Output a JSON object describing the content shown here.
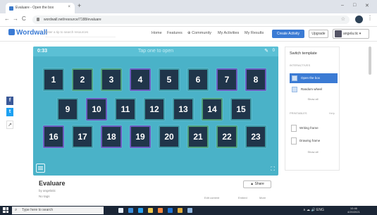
{
  "browser": {
    "tab_title": "Evaluare - Open the box",
    "tab_close": "×",
    "new_tab": "+",
    "window_controls": [
      "–",
      "□",
      "✕"
    ],
    "nav": {
      "back": "←",
      "forward": "→",
      "reload": "C"
    },
    "url": "wordwall.net/resource/7188/evaluare",
    "star": "☆",
    "menu": "⋮"
  },
  "wordwall": {
    "logo": "Wordwall",
    "search_placeholder": "Enter a tip to search resources",
    "nav": [
      "Home",
      "Features",
      "Community",
      "My Activities",
      "My Results"
    ],
    "create_button": "Create Activity",
    "upgrade_button": "Upgrade",
    "user_name": "angela.tic",
    "user_caret": "▾"
  },
  "game": {
    "timer": "0:33",
    "title": "Tap one to open",
    "edit_icon": "✎",
    "count": "0",
    "boxes_row1": [
      "1",
      "2",
      "3",
      "4",
      "5",
      "6",
      "7",
      "8"
    ],
    "boxes_row2": [
      "9",
      "10",
      "11",
      "12",
      "13",
      "14",
      "15"
    ],
    "boxes_row3": [
      "16",
      "17",
      "18",
      "19",
      "20",
      "21",
      "22",
      "23"
    ],
    "fullscreen_icon": "⛶"
  },
  "share_side": {
    "facebook": "f",
    "twitter": "t",
    "link": "↗"
  },
  "sidebar": {
    "title": "Switch template",
    "section1": "INTERACTIVES",
    "options": [
      {
        "label": "Open the box",
        "active": true
      },
      {
        "label": "Random wheel",
        "active": false
      }
    ],
    "show_all_1": "Show all",
    "section2": "PRINTABLES",
    "more": "Help",
    "printables": [
      "Writing frame",
      "Drawing frame"
    ],
    "show_all_2": "Show all"
  },
  "activity": {
    "title": "Evaluare",
    "author": "by angelatic",
    "tags": "No tags",
    "share_button": "Share",
    "links": [
      "Edit content",
      "Embed",
      "More"
    ]
  },
  "taskbar": {
    "search_text": "Type here to search",
    "search_icon": "⌕",
    "tray": "∧ ☁ 🔊 ENG",
    "time": "10:46",
    "date": "4/20/2021",
    "app_colors": [
      "#e8f1ff",
      "#3b8edb",
      "#27a2f2",
      "#f2c94c",
      "#ff8a3d",
      "#1d74d8",
      "#e3ad3b",
      "#8fb6e0"
    ]
  }
}
